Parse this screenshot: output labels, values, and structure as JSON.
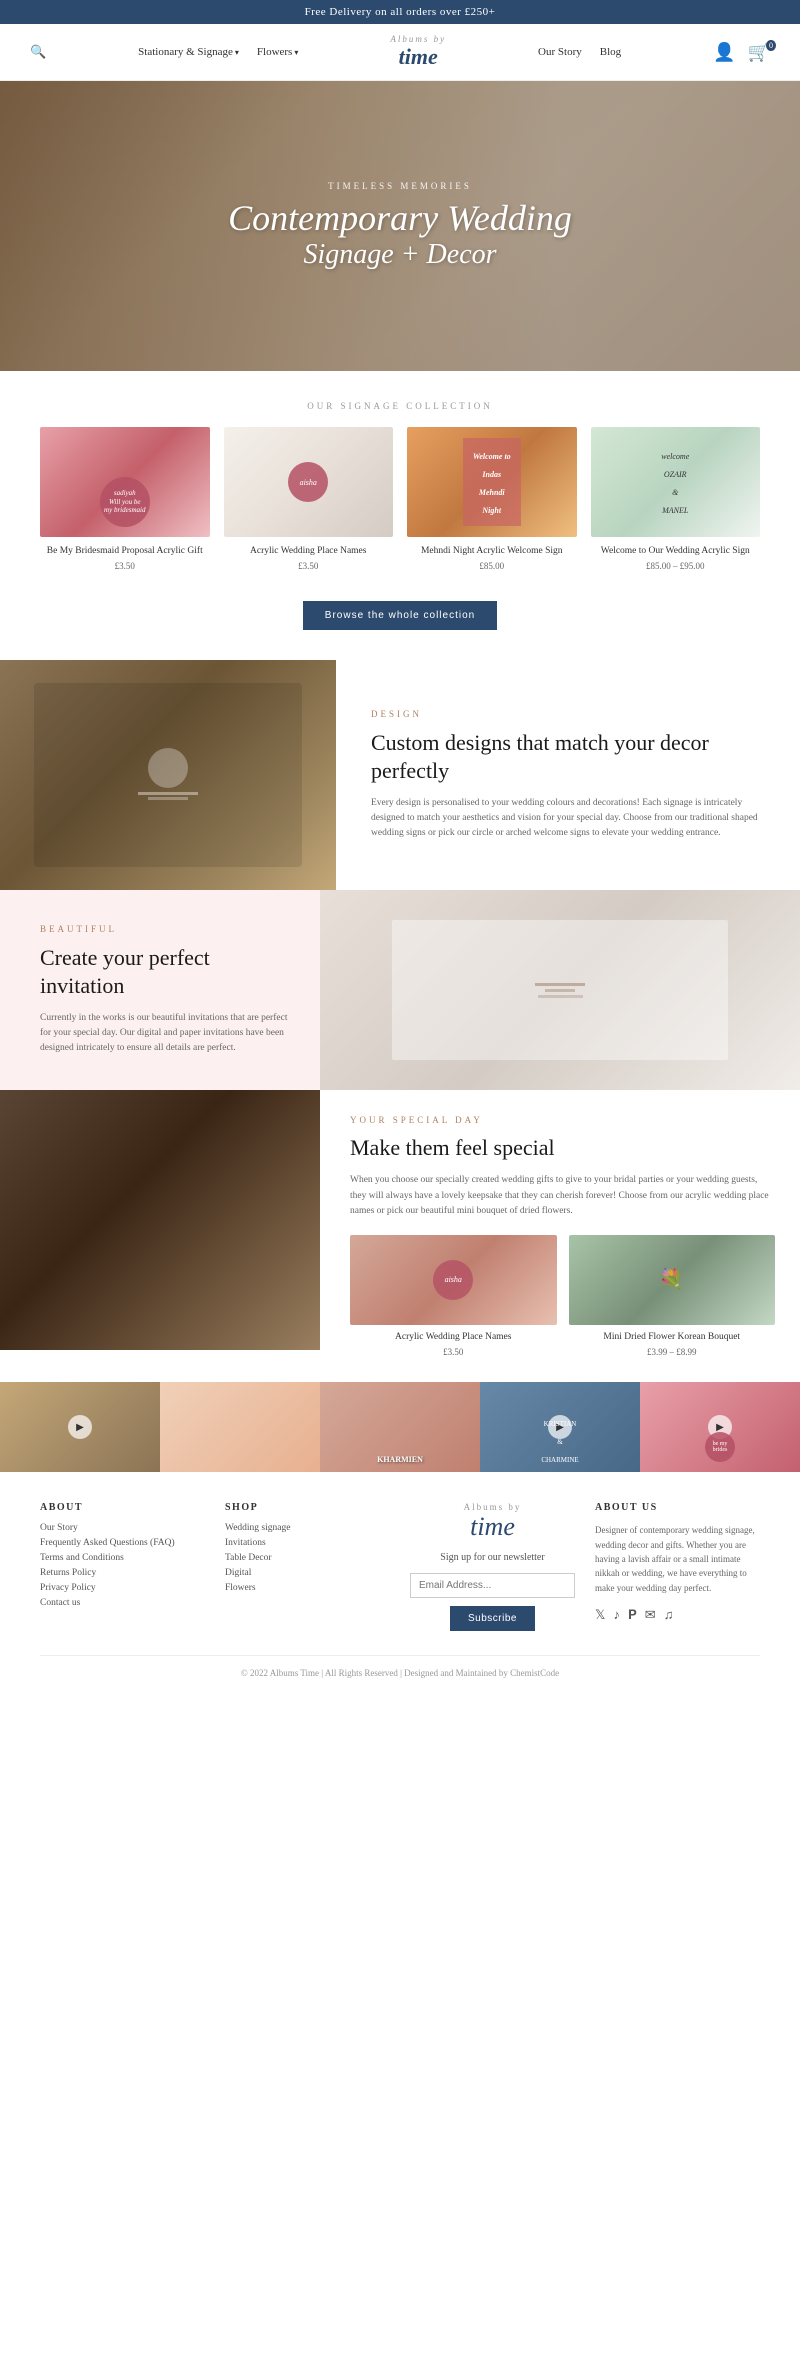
{
  "topBanner": {
    "text": "Free Delivery on all orders over £250+"
  },
  "nav": {
    "searchIcon": "🔍",
    "links": [
      {
        "label": "Stationary & Signage",
        "hasDropdown": true
      },
      {
        "label": "Flowers",
        "hasDropdown": true
      },
      {
        "label": "Our Story"
      },
      {
        "label": "Blog"
      }
    ],
    "logoText": "time",
    "logoSubText": "Albums by",
    "accountIcon": "👤",
    "cartIcon": "🛒",
    "cartCount": "0"
  },
  "hero": {
    "subtitle": "TIMELESS MEMORIES",
    "titleLine1": "Contemporary Wedding",
    "titleLine2": "Signage + Decor"
  },
  "signageSection": {
    "label": "OUR SIGNAGE COLLECTION",
    "products": [
      {
        "name": "Be My Bridesmaid Proposal Acrylic Gift",
        "price": "£3.50",
        "imgClass": "img-pink-signage"
      },
      {
        "name": "Acrylic Wedding Place Names",
        "price": "£3.50",
        "imgClass": "img-white-plate"
      },
      {
        "name": "Mehndi Night Acrylic Welcome Sign",
        "price": "£85.00",
        "imgClass": "img-mehndi"
      },
      {
        "name": "Welcome to Our Wedding Acrylic Sign",
        "price": "£85.00 – £95.00",
        "imgClass": "img-acrylic"
      }
    ],
    "browseLabel": "Browse the whole collection"
  },
  "designSection": {
    "category": "DESIGN",
    "heading": "Custom designs that match your decor perfectly",
    "body": "Every design is personalised to your wedding colours and decorations! Each signage is intricately designed to match your aesthetics and vision for your special day. Choose from our traditional shaped wedding signs or pick our circle or arched welcome signs to elevate your wedding entrance.",
    "imgClass": "img-table-settings"
  },
  "invitationSection": {
    "category": "BEAUTIFUL",
    "heading": "Create your perfect invitation",
    "body": "Currently in the works is our beautiful invitations that are perfect for your special day. Our digital and paper invitations have been designed intricately to ensure all details are perfect.",
    "imgClass": "img-table-white"
  },
  "specialSection": {
    "category": "YOUR SPECIAL DAY",
    "heading": "Make them feel special",
    "body": "When you choose our specially created wedding gifts to give to your bridal parties or your wedding guests, they will always have a lovely keepsake that they can cherish forever! Choose from our acrylic wedding place names or pick our beautiful mini bouquet of dried flowers.",
    "products": [
      {
        "name": "Acrylic Wedding Place Names",
        "price": "£3.50",
        "imgClass": "img-plate-pink"
      },
      {
        "name": "Mini Dried Flower Korean Bouquet",
        "price": "£3.99 – £8.99",
        "imgClass": "img-bouquet"
      }
    ],
    "imgClass": "img-dinner-table"
  },
  "videoRow": [
    {
      "thumbClass": "video-thumb-1",
      "hasPlay": true
    },
    {
      "thumbClass": "video-thumb-2",
      "hasPlay": false
    },
    {
      "thumbClass": "video-thumb-3",
      "hasPlay": false
    },
    {
      "thumbClass": "video-thumb-4",
      "hasPlay": true
    },
    {
      "thumbClass": "video-thumb-5",
      "hasPlay": true
    }
  ],
  "footer": {
    "aboutCol": {
      "heading": "ABOUT",
      "links": [
        "Our Story",
        "Frequently Asked Questions (FAQ)",
        "Terms and Conditions",
        "Returns Policy",
        "Privacy Policy",
        "Contact us"
      ]
    },
    "shopCol": {
      "heading": "SHOP",
      "links": [
        "Wedding signage",
        "Invitations",
        "Table Decor",
        "Digital",
        "Flowers"
      ]
    },
    "newsletter": {
      "logoText": "time",
      "signupLabel": "Sign up for our newsletter",
      "emailPlaceholder": "Email Address...",
      "subscribeLabel": "Subscribe"
    },
    "aboutUs": {
      "heading": "ABOUT US",
      "text": "Designer of contemporary wedding signage, wedding decor and gifts. Whether you are having a lavish affair or a small intimate nikkah or wedding, we have everything to make your wedding day perfect.",
      "socialIcons": [
        "𝕏",
        "♪",
        "𝐏",
        "ℰ",
        "🎵"
      ]
    },
    "copyright": "© 2022 Albums Time | All Rights Reserved | Designed and Maintained by ChemistCode"
  }
}
